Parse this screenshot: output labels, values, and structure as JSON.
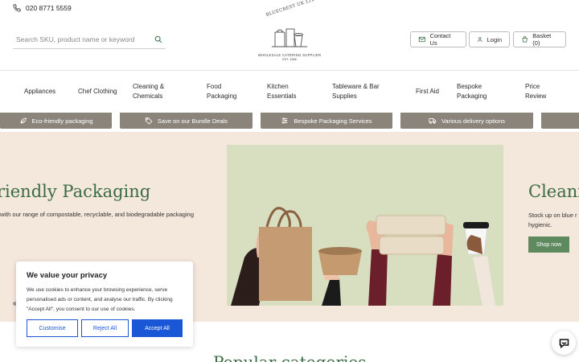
{
  "header": {
    "phone": "020 8771 5559",
    "search_placeholder": "Search SKU, product name or keyword",
    "logo_text": "BLUECREST UK LTD",
    "logo_subtitle": "WHOLESALE CATERING SUPPLIER",
    "logo_est": "EST. 1986",
    "contact_label": "Contact Us",
    "login_label": "Login",
    "basket_label": "Basket (0)"
  },
  "nav": [
    {
      "label": "Appliances"
    },
    {
      "label": "Chef Clothing"
    },
    {
      "label": "Cleaning & Chemicals"
    },
    {
      "label": "Food Packaging"
    },
    {
      "label": "Kitchen Essentials"
    },
    {
      "label": "Tableware & Bar Supplies"
    },
    {
      "label": "First Aid"
    },
    {
      "label": "Bespoke Packaging"
    },
    {
      "label": "Price Review"
    }
  ],
  "strip": [
    {
      "label": "Eco-friendly packaging",
      "icon": "leaf-icon"
    },
    {
      "label": "Save on our Bundle Deals",
      "icon": "tag-icon"
    },
    {
      "label": "Bespoke Packaging Services",
      "icon": "sliders-icon"
    },
    {
      "label": "Various delivery options",
      "icon": "truck-icon"
    }
  ],
  "hero": {
    "title": "riendly Packaging",
    "description": "with our range of compostable, recyclable, and biodegradable packaging",
    "next_title": "Cleani",
    "next_description": "Stock up on blue r hygienic.",
    "shop_label": "Shop now"
  },
  "popular_title": "Popular categories",
  "cookie": {
    "title": "We value your privacy",
    "text": "We use cookies to enhance your browsing experience, serve personalised ads or content, and analyse our traffic. By clicking \"Accept All\", you consent to our use of cookies.",
    "customise": "Customise",
    "reject": "Reject All",
    "accept": "Accept All"
  },
  "colors": {
    "brand_green": "#3b6b45",
    "hero_bg": "#f4e7dc",
    "strip_bg": "#8a847a",
    "cookie_blue": "#1a57d6"
  }
}
